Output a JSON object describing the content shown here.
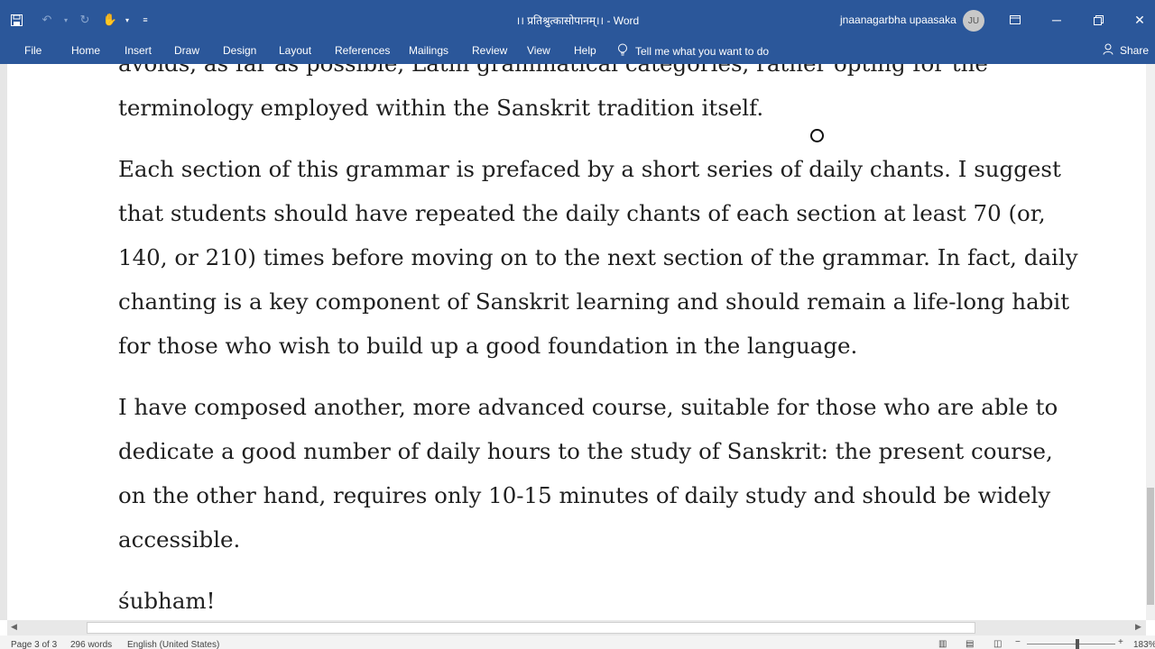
{
  "window": {
    "title": "।। प्रतिश्रुत्कासोपानम्।। - Word",
    "user": "jnaanagarbha upaasaka",
    "user_initials": "JU"
  },
  "ribbon": {
    "tabs": [
      "File",
      "Home",
      "Insert",
      "Draw",
      "Design",
      "Layout",
      "References",
      "Mailings",
      "Review",
      "View",
      "Help"
    ],
    "tell_me": "Tell me what you want to do",
    "share": "Share"
  },
  "document": {
    "paragraphs": [
      {
        "lines": [
          "avoids, as far as possible, Latin grammatical categories, rather opting for the",
          "terminology employed within the Sanskrit tradition itself."
        ]
      },
      {
        "lines": [
          "Each section of this grammar is prefaced by a short series of daily chants. I suggest",
          "that students should have repeated the daily chants of each section at least 70 (or,",
          "140, or 210) times before moving on to the next section of the grammar. In fact, daily",
          "chanting is a key component of Sanskrit learning and should remain a life-long habit",
          "for those who wish to build up a good foundation in the language."
        ]
      },
      {
        "lines": [
          "I have composed another, more advanced course, suitable for those who are able to",
          "dedicate a good number of daily hours to the study of Sanskrit: the present course,",
          "on the other hand, requires only 10-15 minutes of daily study and should be widely",
          "accessible."
        ]
      },
      {
        "lines": [
          "śubham!"
        ]
      }
    ]
  },
  "status": {
    "page": "Page 3 of 3",
    "words": "296 words",
    "language": "English (United States)",
    "zoom": "183%"
  },
  "colors": {
    "titlebar": "#2b579a",
    "text": "#1f1f1f"
  }
}
